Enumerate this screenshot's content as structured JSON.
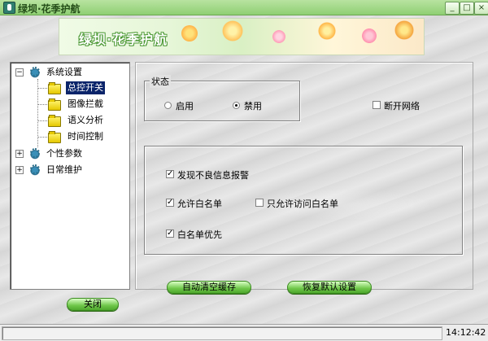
{
  "window": {
    "title": "绿坝·花季护航",
    "min_label": "_",
    "max_label": "□",
    "close_label": "×"
  },
  "banner": {
    "text": "绿坝·花季护航"
  },
  "tree": {
    "items": [
      {
        "label": "系统设置",
        "expander": "−"
      },
      {
        "label": "总控开关"
      },
      {
        "label": "图像拦截"
      },
      {
        "label": "语义分析"
      },
      {
        "label": "时间控制"
      },
      {
        "label": "个性参数",
        "expander": "+"
      },
      {
        "label": "日常维护",
        "expander": "+"
      }
    ],
    "selected": "总控开关"
  },
  "close_button": "关闭",
  "status_group": {
    "title": "状态",
    "enable": "启用",
    "disable": "禁用",
    "selected": "禁用"
  },
  "disconnect": {
    "label": "断开网络",
    "checked": false
  },
  "options": {
    "report_bad_info": {
      "label": "发现不良信息报警",
      "checked": true
    },
    "allow_whitelist": {
      "label": "允许白名单",
      "checked": true
    },
    "only_whitelist": {
      "label": "只允许访问白名单",
      "checked": false
    },
    "whitelist_priority": {
      "label": "白名单优先",
      "checked": true
    }
  },
  "buttons": {
    "auto_clear_cache": "自动清空缓存",
    "restore_defaults": "恢复默认设置"
  },
  "status": {
    "time": "14:12:42"
  },
  "colors": {
    "accent_green": "#6fc74a",
    "selection": "#0a246a",
    "title_green": "#8fcf73"
  }
}
